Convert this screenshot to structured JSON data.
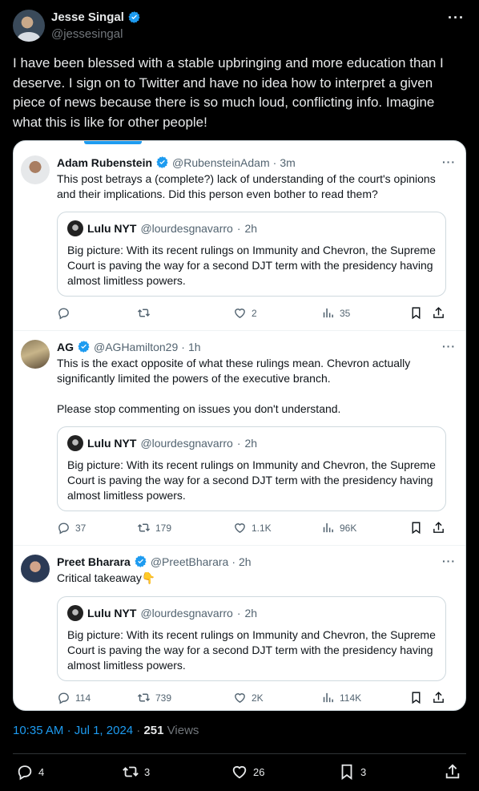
{
  "author": {
    "name": "Jesse Singal",
    "handle": "@jessesingal"
  },
  "tweet_text": "I have been blessed with a stable upbringing and more education than I deserve. I sign on to Twitter and have no idea how to interpret a given piece of news because there is so much loud, conflicting info. Imagine what this is like for other people!",
  "quoted_lulu": {
    "name": "Lulu NYT",
    "handle": "@lourdesgnavarro",
    "sep": "·",
    "time": "2h",
    "text": "Big picture: With its recent rulings on Immunity and Chevron, the Supreme Court is paving the way for a second DJT term with the presidency having almost limitless powers."
  },
  "replies": [
    {
      "name": "Adam Rubenstein",
      "handle": "@RubensteinAdam",
      "sep": "·",
      "time": "3m",
      "text": "This post betrays a (complete?) lack of understanding of the court's opinions and their implications. Did this person even bother to read them?",
      "replies": "",
      "reposts": "",
      "likes": "2",
      "views": "35"
    },
    {
      "name": "AG",
      "handle": "@AGHamilton29",
      "sep": "·",
      "time": "1h",
      "text": "This is the exact opposite of what these rulings mean. Chevron actually significantly limited the powers of the executive branch.",
      "text2": "Please stop commenting on issues you don't understand.",
      "replies": "37",
      "reposts": "179",
      "likes": "1.1K",
      "views": "96K"
    },
    {
      "name": "Preet Bharara",
      "handle": "@PreetBharara",
      "sep": "·",
      "time": "2h",
      "text": "Critical takeaway👇",
      "replies": "114",
      "reposts": "739",
      "likes": "2K",
      "views": "114K"
    }
  ],
  "meta": {
    "time": "10:35 AM",
    "sep": "·",
    "date": "Jul 1, 2024",
    "dot": "·",
    "views": "251",
    "views_label": "Views"
  },
  "stats": {
    "replies": "4",
    "reposts": "3",
    "likes": "26",
    "bookmarks": "3"
  },
  "icons": [
    "verified-icon",
    "more-icon",
    "reply-icon",
    "repost-icon",
    "like-icon",
    "views-icon",
    "bookmark-icon",
    "share-icon"
  ],
  "colors": {
    "accent": "#1d9bf0",
    "background": "#000000",
    "card": "#ffffff"
  }
}
